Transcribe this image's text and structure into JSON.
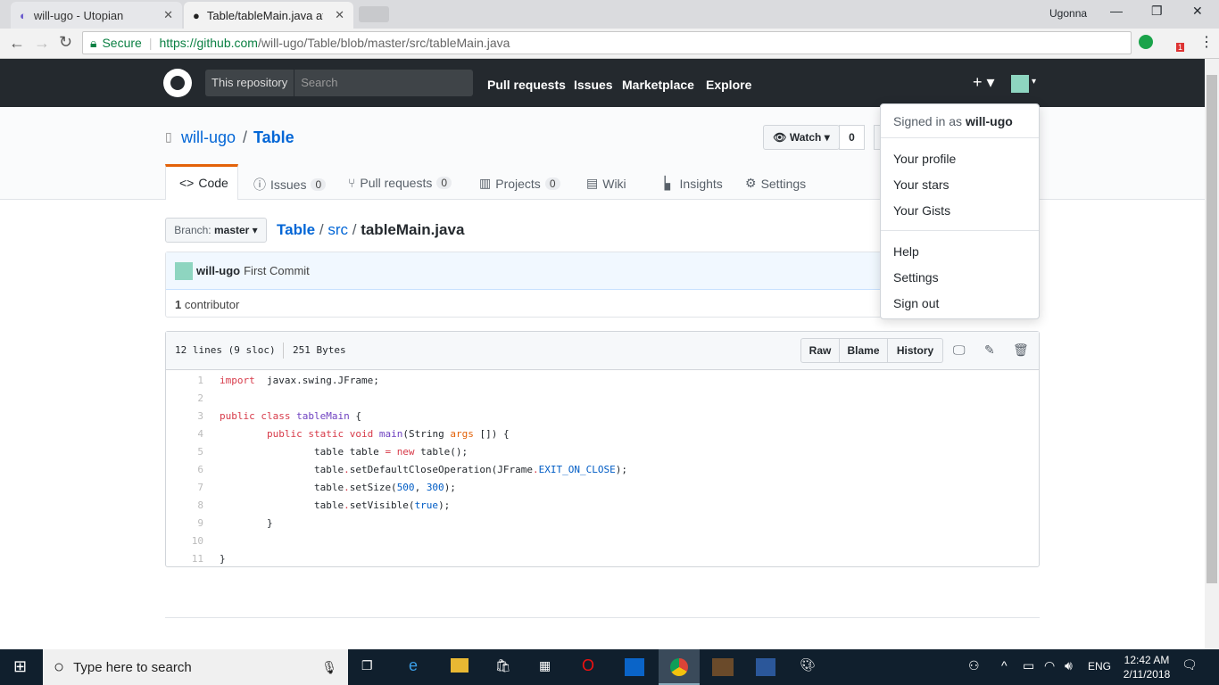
{
  "browser": {
    "tabs": [
      {
        "title": "will-ugo - Utopian"
      },
      {
        "title": "Table/tableMain.java at m"
      }
    ],
    "user": "Ugonna",
    "secure": "Secure",
    "url_host": "https://github.com",
    "url_path": "/will-ugo/Table/blob/master/src/tableMain.java",
    "ext_badge": "1"
  },
  "gh": {
    "scope": "This repository",
    "search_placeholder": "Search",
    "nav": [
      "Pull requests",
      "Issues",
      "Marketplace",
      "Explore"
    ],
    "plus": "+"
  },
  "repo": {
    "owner": "will-ugo",
    "sep": "/",
    "name": "Table",
    "watch": "Watch",
    "watch_count": "0",
    "tabs": [
      {
        "label": "Code"
      },
      {
        "label": "Issues",
        "count": "0"
      },
      {
        "label": "Pull requests",
        "count": "0"
      },
      {
        "label": "Projects",
        "count": "0"
      },
      {
        "label": "Wiki"
      },
      {
        "label": "Insights"
      },
      {
        "label": "Settings"
      }
    ]
  },
  "file": {
    "branch_label": "Branch:",
    "branch": "master",
    "crumbs": [
      "Table",
      "src"
    ],
    "filename": "tableMain.java",
    "commit_author": "will-ugo",
    "commit_msg": "First Commit",
    "contributors_count": "1",
    "contributors_label": "contributor",
    "lines": "12 lines (9 sloc)",
    "size": "251 Bytes",
    "buttons": [
      "Raw",
      "Blame",
      "History"
    ]
  },
  "code": [
    [
      [
        "k",
        "import"
      ],
      [
        "",
        "  javax.swing.JFrame;"
      ]
    ],
    [],
    [
      [
        "k",
        "public"
      ],
      [
        "",
        " "
      ],
      [
        "k",
        "class"
      ],
      [
        "",
        " "
      ],
      [
        "e",
        "tableMain"
      ],
      [
        "",
        " {"
      ]
    ],
    [
      [
        "",
        "        "
      ],
      [
        "k",
        "public"
      ],
      [
        "",
        " "
      ],
      [
        "k",
        "static"
      ],
      [
        "",
        " "
      ],
      [
        "k",
        "void"
      ],
      [
        "",
        " "
      ],
      [
        "e",
        "main"
      ],
      [
        "",
        "(String "
      ],
      [
        "v",
        "args"
      ],
      [
        "",
        " []) {"
      ]
    ],
    [
      [
        "",
        "                table table "
      ],
      [
        "k",
        "="
      ],
      [
        "",
        " "
      ],
      [
        "k",
        "new"
      ],
      [
        "",
        " table();"
      ]
    ],
    [
      [
        "",
        "                table"
      ],
      [
        "k",
        "."
      ],
      [
        "",
        "setDefaultCloseOperation(JFrame"
      ],
      [
        "k",
        "."
      ],
      [
        "c1",
        "EXIT_ON_CLOSE"
      ],
      [
        "",
        ");"
      ]
    ],
    [
      [
        "",
        "                table"
      ],
      [
        "k",
        "."
      ],
      [
        "",
        "setSize("
      ],
      [
        "c1",
        "500"
      ],
      [
        "",
        ", "
      ],
      [
        "c1",
        "300"
      ],
      [
        "",
        ");"
      ]
    ],
    [
      [
        "",
        "                table"
      ],
      [
        "k",
        "."
      ],
      [
        "",
        "setVisible("
      ],
      [
        "c1",
        "true"
      ],
      [
        "",
        ");"
      ]
    ],
    [
      [
        "",
        "        }"
      ]
    ],
    [],
    [
      [
        "",
        "}"
      ]
    ]
  ],
  "menu": {
    "signed_in": "Signed in as",
    "user": "will-ugo",
    "items1": [
      "Your profile",
      "Your stars",
      "Your Gists"
    ],
    "items2": [
      "Help",
      "Settings",
      "Sign out"
    ]
  },
  "taskbar": {
    "search": "Type here to search",
    "lang": "ENG",
    "time": "12:42 AM",
    "date": "2/11/2018"
  }
}
